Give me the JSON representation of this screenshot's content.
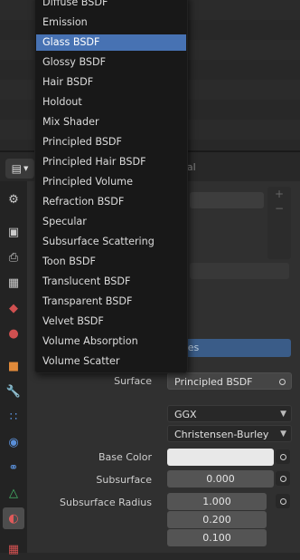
{
  "menu": {
    "items": [
      {
        "label": "Diffuse BSDF",
        "selected": false
      },
      {
        "label": "Emission",
        "selected": false
      },
      {
        "label": "Glass BSDF",
        "selected": true
      },
      {
        "label": "Glossy BSDF",
        "selected": false
      },
      {
        "label": "Hair BSDF",
        "selected": false
      },
      {
        "label": "Holdout",
        "selected": false
      },
      {
        "label": "Mix Shader",
        "selected": false
      },
      {
        "label": "Principled BSDF",
        "selected": false
      },
      {
        "label": "Principled Hair BSDF",
        "selected": false
      },
      {
        "label": "Principled Volume",
        "selected": false
      },
      {
        "label": "Refraction BSDF",
        "selected": false
      },
      {
        "label": "Specular",
        "selected": false
      },
      {
        "label": "Subsurface Scattering",
        "selected": false
      },
      {
        "label": "Toon BSDF",
        "selected": false
      },
      {
        "label": "Translucent BSDF",
        "selected": false
      },
      {
        "label": "Transparent BSDF",
        "selected": false
      },
      {
        "label": "Velvet BSDF",
        "selected": false
      },
      {
        "label": "Volume Absorption",
        "selected": false
      },
      {
        "label": "Volume Scatter",
        "selected": false
      }
    ]
  },
  "header": {
    "tab_label": "Material",
    "use_nodes_label": "Use Nodes"
  },
  "surface": {
    "label": "Surface",
    "value": "Principled BSDF",
    "distribution": "GGX",
    "subsurface_method": "Christensen-Burley"
  },
  "properties": {
    "base_color_label": "Base Color",
    "base_color_value": "#e8e8e8",
    "subsurface_label": "Subsurface",
    "subsurface_value": "0.000",
    "subsurface_radius_label": "Subsurface Radius",
    "subsurface_radius": [
      "1.000",
      "0.200",
      "0.100"
    ]
  },
  "colors": {
    "menu_bg": "#181818",
    "selection": "#4772b3",
    "panel_bg": "#303030"
  }
}
